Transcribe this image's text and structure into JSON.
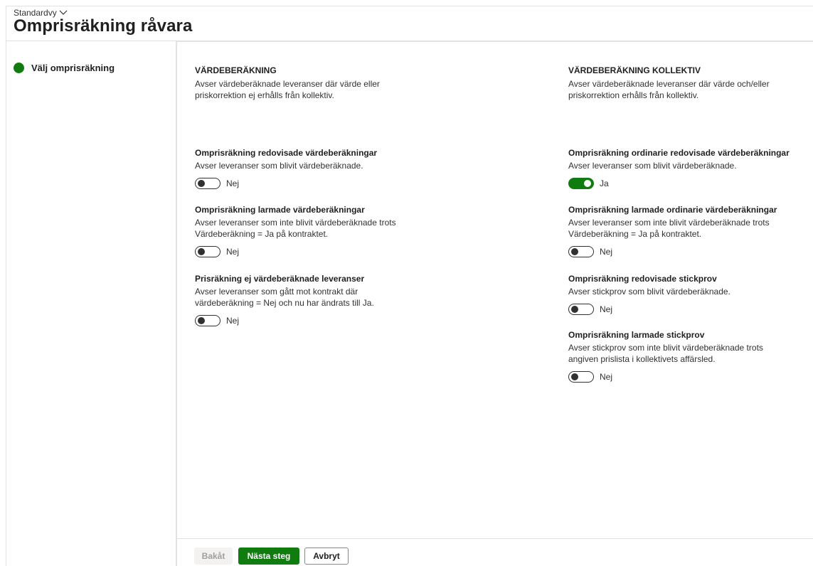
{
  "header": {
    "view_selector": "Standardvy",
    "title": "Omprisräkning råvara"
  },
  "sidebar": {
    "steps": [
      {
        "label": "Välj omprisräkning",
        "status_color": "#107c10"
      }
    ]
  },
  "main": {
    "left_column": {
      "heading": "VÄRDEBERÄKNING",
      "description": "Avser värdeberäknade leveranser där värde eller priskorrektion ej erhålls från kollektiv.",
      "fields": [
        {
          "title": "Omprisräkning redovisade värdeberäkningar",
          "description": "Avser leveranser som blivit värdeberäknade.",
          "on": false,
          "state_label": "Nej"
        },
        {
          "title": "Omprisräkning larmade värdeberäkningar",
          "description": "Avser leveranser som inte blivit värdeberäknade trots Värdeberäkning = Ja på kontraktet.",
          "on": false,
          "state_label": "Nej"
        },
        {
          "title": "Prisräkning ej värdeberäknade leveranser",
          "description": "Avser leveranser som gått mot kontrakt där värdeberäkning = Nej och nu har ändrats till Ja.",
          "on": false,
          "state_label": "Nej"
        }
      ]
    },
    "right_column": {
      "heading": "VÄRDEBERÄKNING KOLLEKTIV",
      "description": "Avser värdeberäknade leveranser där värde och/eller priskorrektion erhålls från kollektiv.",
      "fields": [
        {
          "title": "Omprisräkning ordinarie redovisade värdeberäkningar",
          "description": "Avser leveranser som blivit värdeberäknade.",
          "on": true,
          "state_label": "Ja"
        },
        {
          "title": "Omprisräkning larmade ordinarie värdeberäkningar",
          "description": "Avser leveranser som inte blivit värdeberäknade trots Värdeberäkning = Ja på kontraktet.",
          "on": false,
          "state_label": "Nej"
        },
        {
          "title": "Omprisräkning redovisade stickprov",
          "description": "Avser stickprov som blivit värdeberäknade.",
          "on": false,
          "state_label": "Nej"
        },
        {
          "title": "Omprisräkning larmade stickprov",
          "description": "Avser stickprov som inte blivit värdeberäknade trots angiven prislista i kollektivets affärsled.",
          "on": false,
          "state_label": "Nej"
        }
      ]
    }
  },
  "footer": {
    "back_label": "Bakåt",
    "next_label": "Nästa steg",
    "cancel_label": "Avbryt"
  },
  "colors": {
    "accent": "#107c10",
    "disabled_text": "#a19f9d"
  }
}
